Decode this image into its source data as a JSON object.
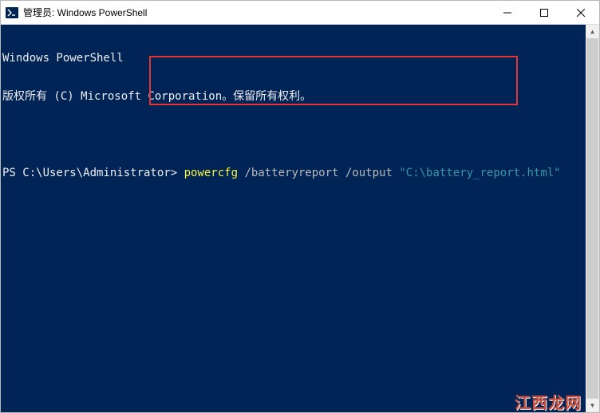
{
  "window": {
    "title": "管理员: Windows PowerShell"
  },
  "controls": {
    "minimize": "—",
    "maximize": "□",
    "close": "✕"
  },
  "terminal": {
    "header_line1": "Windows PowerShell",
    "header_line2": "版权所有 (C) Microsoft Corporation。保留所有权利。",
    "prompt": "PS C:\\Users\\Administrator> ",
    "cmd_part1": "powercfg",
    "cmd_part2": " /batteryreport /output ",
    "cmd_part3": "\"C:\\battery_report.html\""
  },
  "scrollbar": {
    "up": "▲",
    "down": "▼"
  },
  "watermark": "江西龙网"
}
